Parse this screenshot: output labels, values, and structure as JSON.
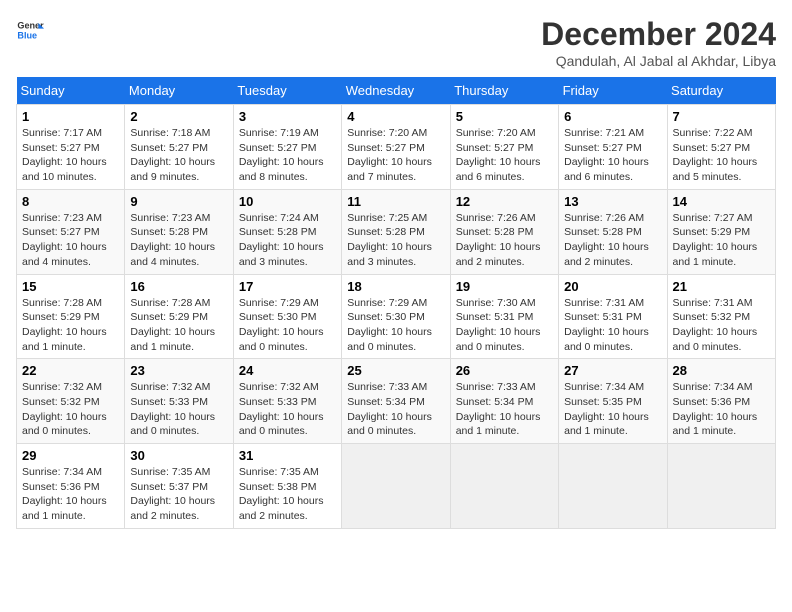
{
  "logo": {
    "text_general": "General",
    "text_blue": "Blue"
  },
  "title": "December 2024",
  "subtitle": "Qandulah, Al Jabal al Akhdar, Libya",
  "weekdays": [
    "Sunday",
    "Monday",
    "Tuesday",
    "Wednesday",
    "Thursday",
    "Friday",
    "Saturday"
  ],
  "weeks": [
    [
      {
        "day": 1,
        "info": "Sunrise: 7:17 AM\nSunset: 5:27 PM\nDaylight: 10 hours\nand 10 minutes."
      },
      {
        "day": 2,
        "info": "Sunrise: 7:18 AM\nSunset: 5:27 PM\nDaylight: 10 hours\nand 9 minutes."
      },
      {
        "day": 3,
        "info": "Sunrise: 7:19 AM\nSunset: 5:27 PM\nDaylight: 10 hours\nand 8 minutes."
      },
      {
        "day": 4,
        "info": "Sunrise: 7:20 AM\nSunset: 5:27 PM\nDaylight: 10 hours\nand 7 minutes."
      },
      {
        "day": 5,
        "info": "Sunrise: 7:20 AM\nSunset: 5:27 PM\nDaylight: 10 hours\nand 6 minutes."
      },
      {
        "day": 6,
        "info": "Sunrise: 7:21 AM\nSunset: 5:27 PM\nDaylight: 10 hours\nand 6 minutes."
      },
      {
        "day": 7,
        "info": "Sunrise: 7:22 AM\nSunset: 5:27 PM\nDaylight: 10 hours\nand 5 minutes."
      }
    ],
    [
      {
        "day": 8,
        "info": "Sunrise: 7:23 AM\nSunset: 5:27 PM\nDaylight: 10 hours\nand 4 minutes."
      },
      {
        "day": 9,
        "info": "Sunrise: 7:23 AM\nSunset: 5:28 PM\nDaylight: 10 hours\nand 4 minutes."
      },
      {
        "day": 10,
        "info": "Sunrise: 7:24 AM\nSunset: 5:28 PM\nDaylight: 10 hours\nand 3 minutes."
      },
      {
        "day": 11,
        "info": "Sunrise: 7:25 AM\nSunset: 5:28 PM\nDaylight: 10 hours\nand 3 minutes."
      },
      {
        "day": 12,
        "info": "Sunrise: 7:26 AM\nSunset: 5:28 PM\nDaylight: 10 hours\nand 2 minutes."
      },
      {
        "day": 13,
        "info": "Sunrise: 7:26 AM\nSunset: 5:28 PM\nDaylight: 10 hours\nand 2 minutes."
      },
      {
        "day": 14,
        "info": "Sunrise: 7:27 AM\nSunset: 5:29 PM\nDaylight: 10 hours\nand 1 minute."
      }
    ],
    [
      {
        "day": 15,
        "info": "Sunrise: 7:28 AM\nSunset: 5:29 PM\nDaylight: 10 hours\nand 1 minute."
      },
      {
        "day": 16,
        "info": "Sunrise: 7:28 AM\nSunset: 5:29 PM\nDaylight: 10 hours\nand 1 minute."
      },
      {
        "day": 17,
        "info": "Sunrise: 7:29 AM\nSunset: 5:30 PM\nDaylight: 10 hours\nand 0 minutes."
      },
      {
        "day": 18,
        "info": "Sunrise: 7:29 AM\nSunset: 5:30 PM\nDaylight: 10 hours\nand 0 minutes."
      },
      {
        "day": 19,
        "info": "Sunrise: 7:30 AM\nSunset: 5:31 PM\nDaylight: 10 hours\nand 0 minutes."
      },
      {
        "day": 20,
        "info": "Sunrise: 7:31 AM\nSunset: 5:31 PM\nDaylight: 10 hours\nand 0 minutes."
      },
      {
        "day": 21,
        "info": "Sunrise: 7:31 AM\nSunset: 5:32 PM\nDaylight: 10 hours\nand 0 minutes."
      }
    ],
    [
      {
        "day": 22,
        "info": "Sunrise: 7:32 AM\nSunset: 5:32 PM\nDaylight: 10 hours\nand 0 minutes."
      },
      {
        "day": 23,
        "info": "Sunrise: 7:32 AM\nSunset: 5:33 PM\nDaylight: 10 hours\nand 0 minutes."
      },
      {
        "day": 24,
        "info": "Sunrise: 7:32 AM\nSunset: 5:33 PM\nDaylight: 10 hours\nand 0 minutes."
      },
      {
        "day": 25,
        "info": "Sunrise: 7:33 AM\nSunset: 5:34 PM\nDaylight: 10 hours\nand 0 minutes."
      },
      {
        "day": 26,
        "info": "Sunrise: 7:33 AM\nSunset: 5:34 PM\nDaylight: 10 hours\nand 1 minute."
      },
      {
        "day": 27,
        "info": "Sunrise: 7:34 AM\nSunset: 5:35 PM\nDaylight: 10 hours\nand 1 minute."
      },
      {
        "day": 28,
        "info": "Sunrise: 7:34 AM\nSunset: 5:36 PM\nDaylight: 10 hours\nand 1 minute."
      }
    ],
    [
      {
        "day": 29,
        "info": "Sunrise: 7:34 AM\nSunset: 5:36 PM\nDaylight: 10 hours\nand 1 minute."
      },
      {
        "day": 30,
        "info": "Sunrise: 7:35 AM\nSunset: 5:37 PM\nDaylight: 10 hours\nand 2 minutes."
      },
      {
        "day": 31,
        "info": "Sunrise: 7:35 AM\nSunset: 5:38 PM\nDaylight: 10 hours\nand 2 minutes."
      },
      null,
      null,
      null,
      null
    ]
  ]
}
